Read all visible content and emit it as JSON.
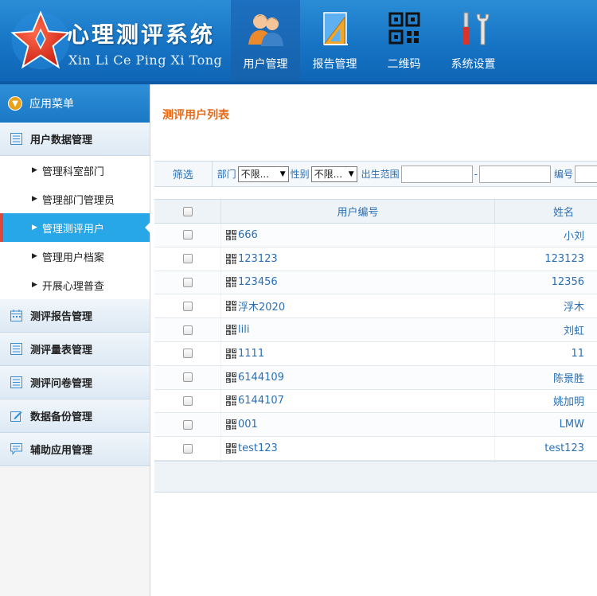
{
  "header": {
    "title": "心理测评系统",
    "subtitle": "Xin Li Ce Ping Xi Tong",
    "nav": [
      {
        "label": "用户管理",
        "icon": "users-icon",
        "active": true
      },
      {
        "label": "报告管理",
        "icon": "report-ruler-icon",
        "active": false
      },
      {
        "label": "二维码",
        "icon": "qrcode-icon",
        "active": false
      },
      {
        "label": "系统设置",
        "icon": "tools-icon",
        "active": false
      }
    ]
  },
  "sidebar": {
    "menu_title": "应用菜单",
    "groups": [
      {
        "label": "用户数据管理",
        "icon": "list-icon"
      },
      {
        "label": "测评报告管理",
        "icon": "calendar-icon"
      },
      {
        "label": "测评量表管理",
        "icon": "list-icon"
      },
      {
        "label": "测评问卷管理",
        "icon": "list-icon"
      },
      {
        "label": "数据备份管理",
        "icon": "edit-icon"
      },
      {
        "label": "辅助应用管理",
        "icon": "chat-icon"
      }
    ],
    "sub_items": [
      {
        "label": "管理科室部门",
        "active": false
      },
      {
        "label": "管理部门管理员",
        "active": false
      },
      {
        "label": "管理测评用户",
        "active": true
      },
      {
        "label": "管理用户档案",
        "active": false
      },
      {
        "label": "开展心理普查",
        "active": false
      }
    ]
  },
  "main": {
    "page_title": "测评用户列表",
    "filter": {
      "label": "筛选",
      "dept_label": "部门",
      "dept_value": "不限...",
      "gender_label": "性别",
      "gender_value": "不限...",
      "birth_label": "出生范围",
      "range_sep": "-",
      "code_label": "编号"
    },
    "table": {
      "headers": {
        "id": "用户编号",
        "name": "姓名"
      },
      "rows": [
        {
          "id": "666",
          "name": "小刘"
        },
        {
          "id": "123123",
          "name": "123123"
        },
        {
          "id": "123456",
          "name": "12356"
        },
        {
          "id": "浮木2020",
          "name": "浮木"
        },
        {
          "id": "lili",
          "name": "刘虹"
        },
        {
          "id": "1111",
          "name": "11"
        },
        {
          "id": "6144109",
          "name": "陈景胜"
        },
        {
          "id": "6144107",
          "name": "姚加明"
        },
        {
          "id": "001",
          "name": "LMW"
        },
        {
          "id": "test123",
          "name": "test123"
        }
      ]
    }
  },
  "colors": {
    "header_blue": "#1673c4",
    "active_nav_underline": "#7fcf2b",
    "sidebar_active": "#27a6e8",
    "title_orange": "#e46a1b",
    "link_blue": "#2a6fb5"
  }
}
